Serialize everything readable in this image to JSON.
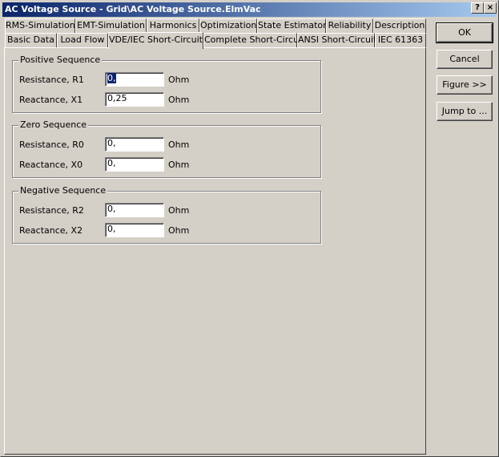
{
  "window": {
    "title": "AC Voltage Source - Grid\\AC Voltage Source.ElmVac",
    "help_label": "?",
    "close_label": "×"
  },
  "tabs_row1": [
    {
      "label": "RMS-Simulation"
    },
    {
      "label": "EMT-Simulation"
    },
    {
      "label": "Harmonics"
    },
    {
      "label": "Optimization"
    },
    {
      "label": "State Estimator"
    },
    {
      "label": "Reliability"
    },
    {
      "label": "Description"
    }
  ],
  "tabs_row2": [
    {
      "label": "Basic Data"
    },
    {
      "label": "Load Flow"
    },
    {
      "label": "VDE/IEC Short-Circuit"
    },
    {
      "label": "Complete Short-Circuit"
    },
    {
      "label": "ANSI Short-Circuit"
    },
    {
      "label": "IEC 61363"
    }
  ],
  "groups": {
    "positive": {
      "title": "Positive Sequence",
      "r_label": "Resistance, R1",
      "r_value": "0,",
      "r_unit": "Ohm",
      "x_label": "Reactance, X1",
      "x_value": "0,25",
      "x_unit": "Ohm"
    },
    "zero": {
      "title": "Zero Sequence",
      "r_label": "Resistance, R0",
      "r_value": "0,",
      "r_unit": "Ohm",
      "x_label": "Reactance, X0",
      "x_value": "0,",
      "x_unit": "Ohm"
    },
    "negative": {
      "title": "Negative Sequence",
      "r_label": "Resistance, R2",
      "r_value": "0,",
      "r_unit": "Ohm",
      "x_label": "Reactance, X2",
      "x_value": "0,",
      "x_unit": "Ohm"
    }
  },
  "buttons": {
    "ok": "OK",
    "cancel": "Cancel",
    "figure": "Figure >>",
    "jump": "Jump to ..."
  }
}
